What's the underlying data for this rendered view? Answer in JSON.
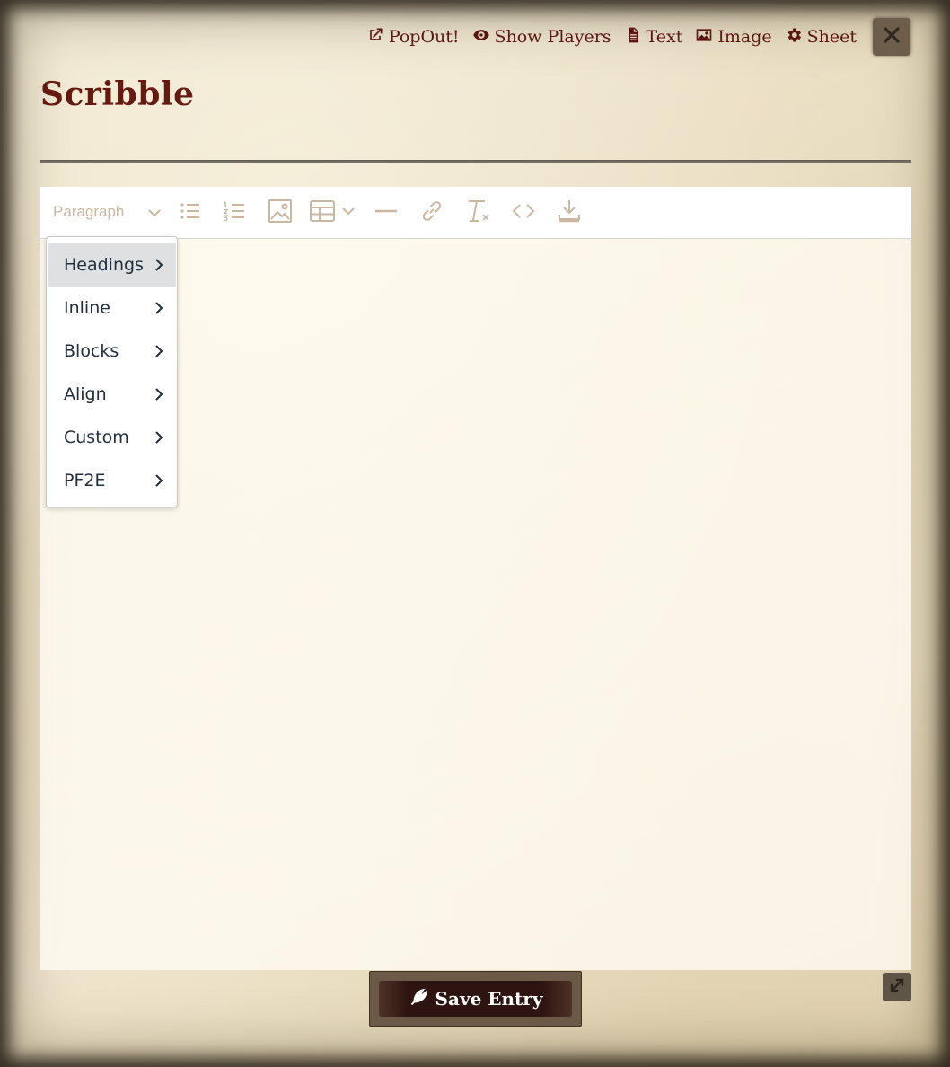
{
  "window": {
    "title": "Scribble",
    "header_buttons": [
      {
        "label": "PopOut!",
        "icon": "external-link-icon"
      },
      {
        "label": "Show Players",
        "icon": "eye-icon"
      },
      {
        "label": "Text",
        "icon": "document-icon"
      },
      {
        "label": "Image",
        "icon": "image-icon"
      },
      {
        "label": "Sheet",
        "icon": "gear-icon"
      }
    ],
    "close_icon": "close-icon"
  },
  "toolbar": {
    "block_format": "Paragraph",
    "icons": [
      "bullet-list-icon",
      "numbered-list-icon",
      "insert-image-icon",
      "table-icon",
      "horizontal-rule-icon",
      "link-icon",
      "clear-formatting-icon",
      "source-code-icon",
      "save-download-icon"
    ]
  },
  "format_menu": {
    "items": [
      {
        "label": "Headings",
        "active": true
      },
      {
        "label": "Inline"
      },
      {
        "label": "Blocks"
      },
      {
        "label": "Align"
      },
      {
        "label": "Custom"
      },
      {
        "label": "PF2E"
      }
    ]
  },
  "footer": {
    "save_label": "Save Entry",
    "save_icon": "feather-icon",
    "resize_icon": "resize-icon"
  },
  "colors": {
    "title": "#641a10",
    "header_text": "#5c1610",
    "toolbar_icon": "#c9b7a0",
    "menu_text": "#222f3e",
    "menu_active_bg": "#dee0e2"
  }
}
